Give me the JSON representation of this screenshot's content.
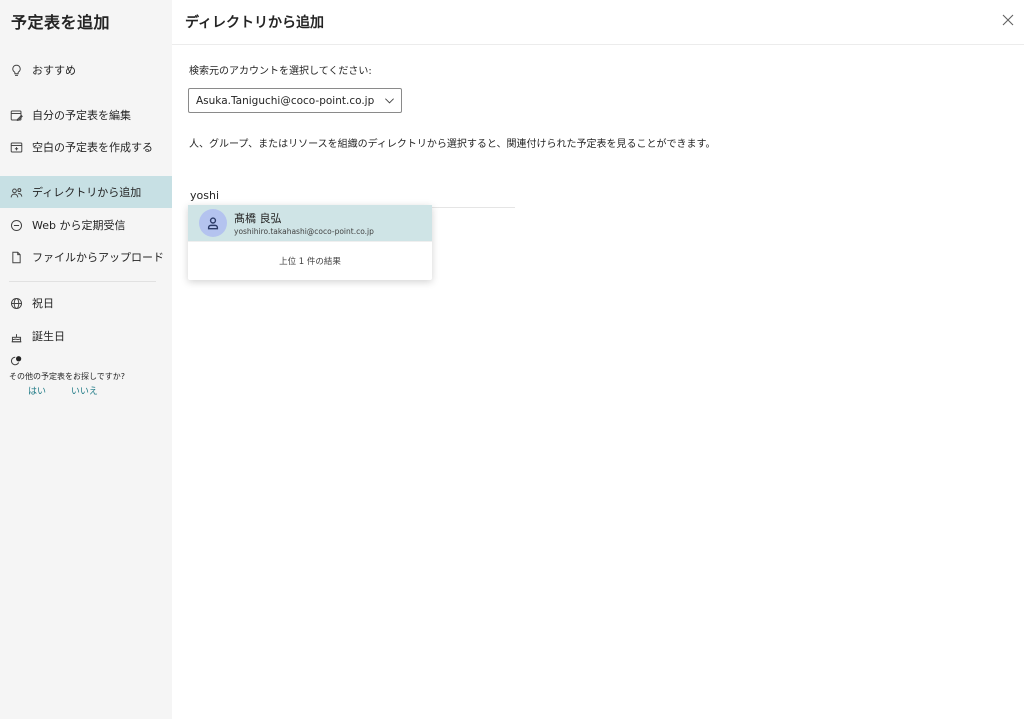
{
  "sidebar": {
    "title": "予定表を追加",
    "items": [
      {
        "label": "おすすめ",
        "icon": "lightbulb-icon"
      },
      {
        "label": "自分の予定表を編集",
        "icon": "edit-calendar-icon"
      },
      {
        "label": "空白の予定表を作成する",
        "icon": "add-calendar-icon"
      },
      {
        "label": "ディレクトリから追加",
        "icon": "people-icon"
      },
      {
        "label": "Web から定期受信",
        "icon": "link-icon"
      },
      {
        "label": "ファイルからアップロード",
        "icon": "document-icon"
      },
      {
        "label": "祝日",
        "icon": "globe-icon"
      },
      {
        "label": "誕生日",
        "icon": "cake-icon"
      }
    ],
    "more_question": "その他の予定表をお探しですか?",
    "yes_label": "はい",
    "no_label": "いいえ"
  },
  "main": {
    "title": "ディレクトリから追加",
    "account_label": "検索元のアカウントを選択してください:",
    "account_value": "Asuka.Taniguchi@coco-point.co.jp",
    "description": "人、グループ、またはリソースを組織のディレクトリから選択すると、関連付けられた予定表を見ることができます。",
    "search_value": "yoshi",
    "results": [
      {
        "name": "髙橋 良弘",
        "email": "yoshihiro.takahashi@coco-point.co.jp"
      }
    ],
    "results_footer": "上位 1 件の結果"
  },
  "colors": {
    "active_nav": "#c7e0e4",
    "result_highlight": "#cfe4e6",
    "avatar_bg": "#b4c3ef",
    "link": "#1f7a86"
  }
}
